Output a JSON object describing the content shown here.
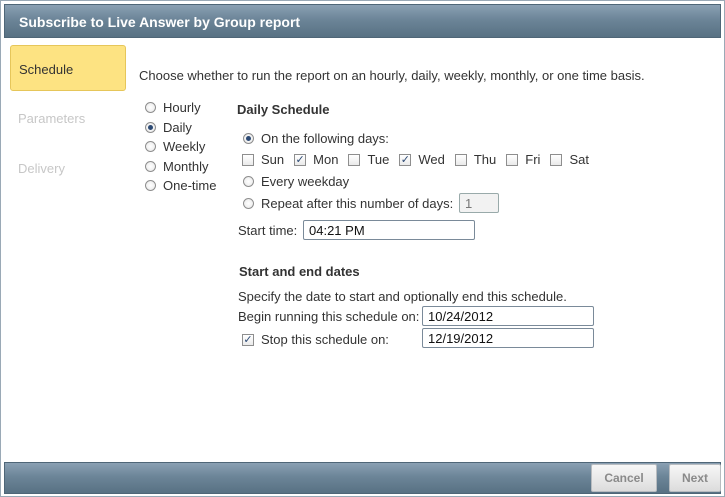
{
  "dialog": {
    "title": "Subscribe to Live Answer by Group report"
  },
  "nav": [
    {
      "label": "Schedule",
      "active": true
    },
    {
      "label": "Parameters",
      "active": false
    },
    {
      "label": "Delivery",
      "active": false
    }
  ],
  "intro": "Choose whether to run the report on an hourly, daily, weekly, monthly, or one time basis.",
  "frequency": {
    "selected": "Daily",
    "options": [
      "Hourly",
      "Daily",
      "Weekly",
      "Monthly",
      "One-time"
    ]
  },
  "daily_schedule": {
    "heading": "Daily Schedule",
    "on_following_days_label": "On the following days:",
    "days": [
      {
        "label": "Sun",
        "checked": false
      },
      {
        "label": "Mon",
        "checked": true
      },
      {
        "label": "Tue",
        "checked": false
      },
      {
        "label": "Wed",
        "checked": true
      },
      {
        "label": "Thu",
        "checked": false
      },
      {
        "label": "Fri",
        "checked": false
      },
      {
        "label": "Sat",
        "checked": false
      }
    ],
    "every_weekday_label": "Every weekday",
    "repeat_label": "Repeat after this number of days:",
    "repeat_value": "1",
    "start_time_label": "Start time:",
    "start_time_value": "04:21 PM"
  },
  "dates": {
    "heading": "Start and end dates",
    "description": "Specify the date to start and optionally end this schedule.",
    "begin_label": "Begin running this schedule on:",
    "begin_value": "10/24/2012",
    "stop_label": "Stop this schedule on:",
    "stop_checked": true,
    "stop_value": "12/19/2012"
  },
  "footer": {
    "cancel_label": "Cancel",
    "next_label": "Next"
  },
  "glyphs": {
    "check": "✓"
  }
}
